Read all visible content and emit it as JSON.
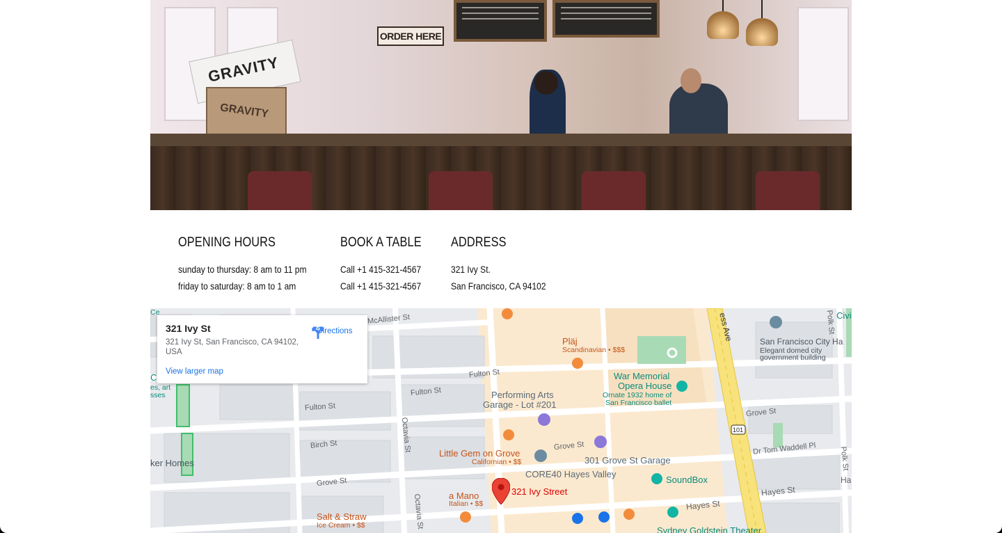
{
  "hero": {
    "sign_text": "ORDER HERE",
    "box_text": "GRAVITY",
    "magazine_text": "GRAVITY"
  },
  "info": {
    "columns": [
      {
        "heading": "OPENING HOURS",
        "lines": [
          "sunday to thursday: 8 am to 11 pm",
          "friday to saturday: 8 am to 1 am"
        ]
      },
      {
        "heading": "BOOK A TABLE",
        "lines": [
          "Call +1 415-321-4567",
          "Call +1 415-321-4567"
        ]
      },
      {
        "heading": "ADDRESS",
        "lines": [
          "321 Ivy St.",
          "San Francisco, CA 94102"
        ]
      }
    ]
  },
  "map": {
    "card": {
      "title": "321 Ivy St",
      "address": "321 Ivy St, San Francisco, CA 94102, USA",
      "directions_label": "Directions",
      "larger_map_label": "View larger map"
    },
    "marker_label": "321 Ivy Street",
    "streets": {
      "mcallister": "McAllister St",
      "fulton1": "Fulton St",
      "fulton2": "Fulton St",
      "fulton3": "Fulton St",
      "birch": "Birch St",
      "grove1": "Grove St",
      "grove2": "Grove St",
      "grove3": "Grove St",
      "octavia1": "Octavia St",
      "octavia2": "Octavia St",
      "hayes1": "Hayes St",
      "hayes2": "Hayes St",
      "hayes3": "Ha",
      "polk1": "Polk St",
      "polk2": "Polk St",
      "tom": "Dr Tom Waddell Pl",
      "van_ness": "ess Ave",
      "hwy": "101"
    },
    "pois": {
      "plaj": "Plӓj",
      "plaj_sub": "Scandinavian • $$$",
      "war": "War Memorial",
      "opera": "Opera House",
      "opera_sub1": "Ornate 1932 home of",
      "opera_sub2": "San Francisco ballet",
      "perf1": "Performing Arts",
      "perf2": "Garage - Lot #201",
      "little": "Little Gem on Grove",
      "little_sub": "Californian • $$",
      "core": "CORE40 Hayes Valley",
      "garage301": "301 Grove St Garage",
      "soundbox": "SoundBox",
      "amano": "a Mano",
      "amano_sub": "Italian • $$",
      "salt": "Salt & Straw",
      "salt_sub": "Ice Cream • $$",
      "sydney": "Sydney Goldstein Theater",
      "sfcity1": "San Francisco City Ha",
      "sfcity2": "Elegant domed city",
      "sfcity3": "government building",
      "civic": "Civi",
      "homes": "ker Homes",
      "left1": "Ce",
      "left2": "C",
      "left3": "es, art",
      "left4": "sses"
    }
  }
}
